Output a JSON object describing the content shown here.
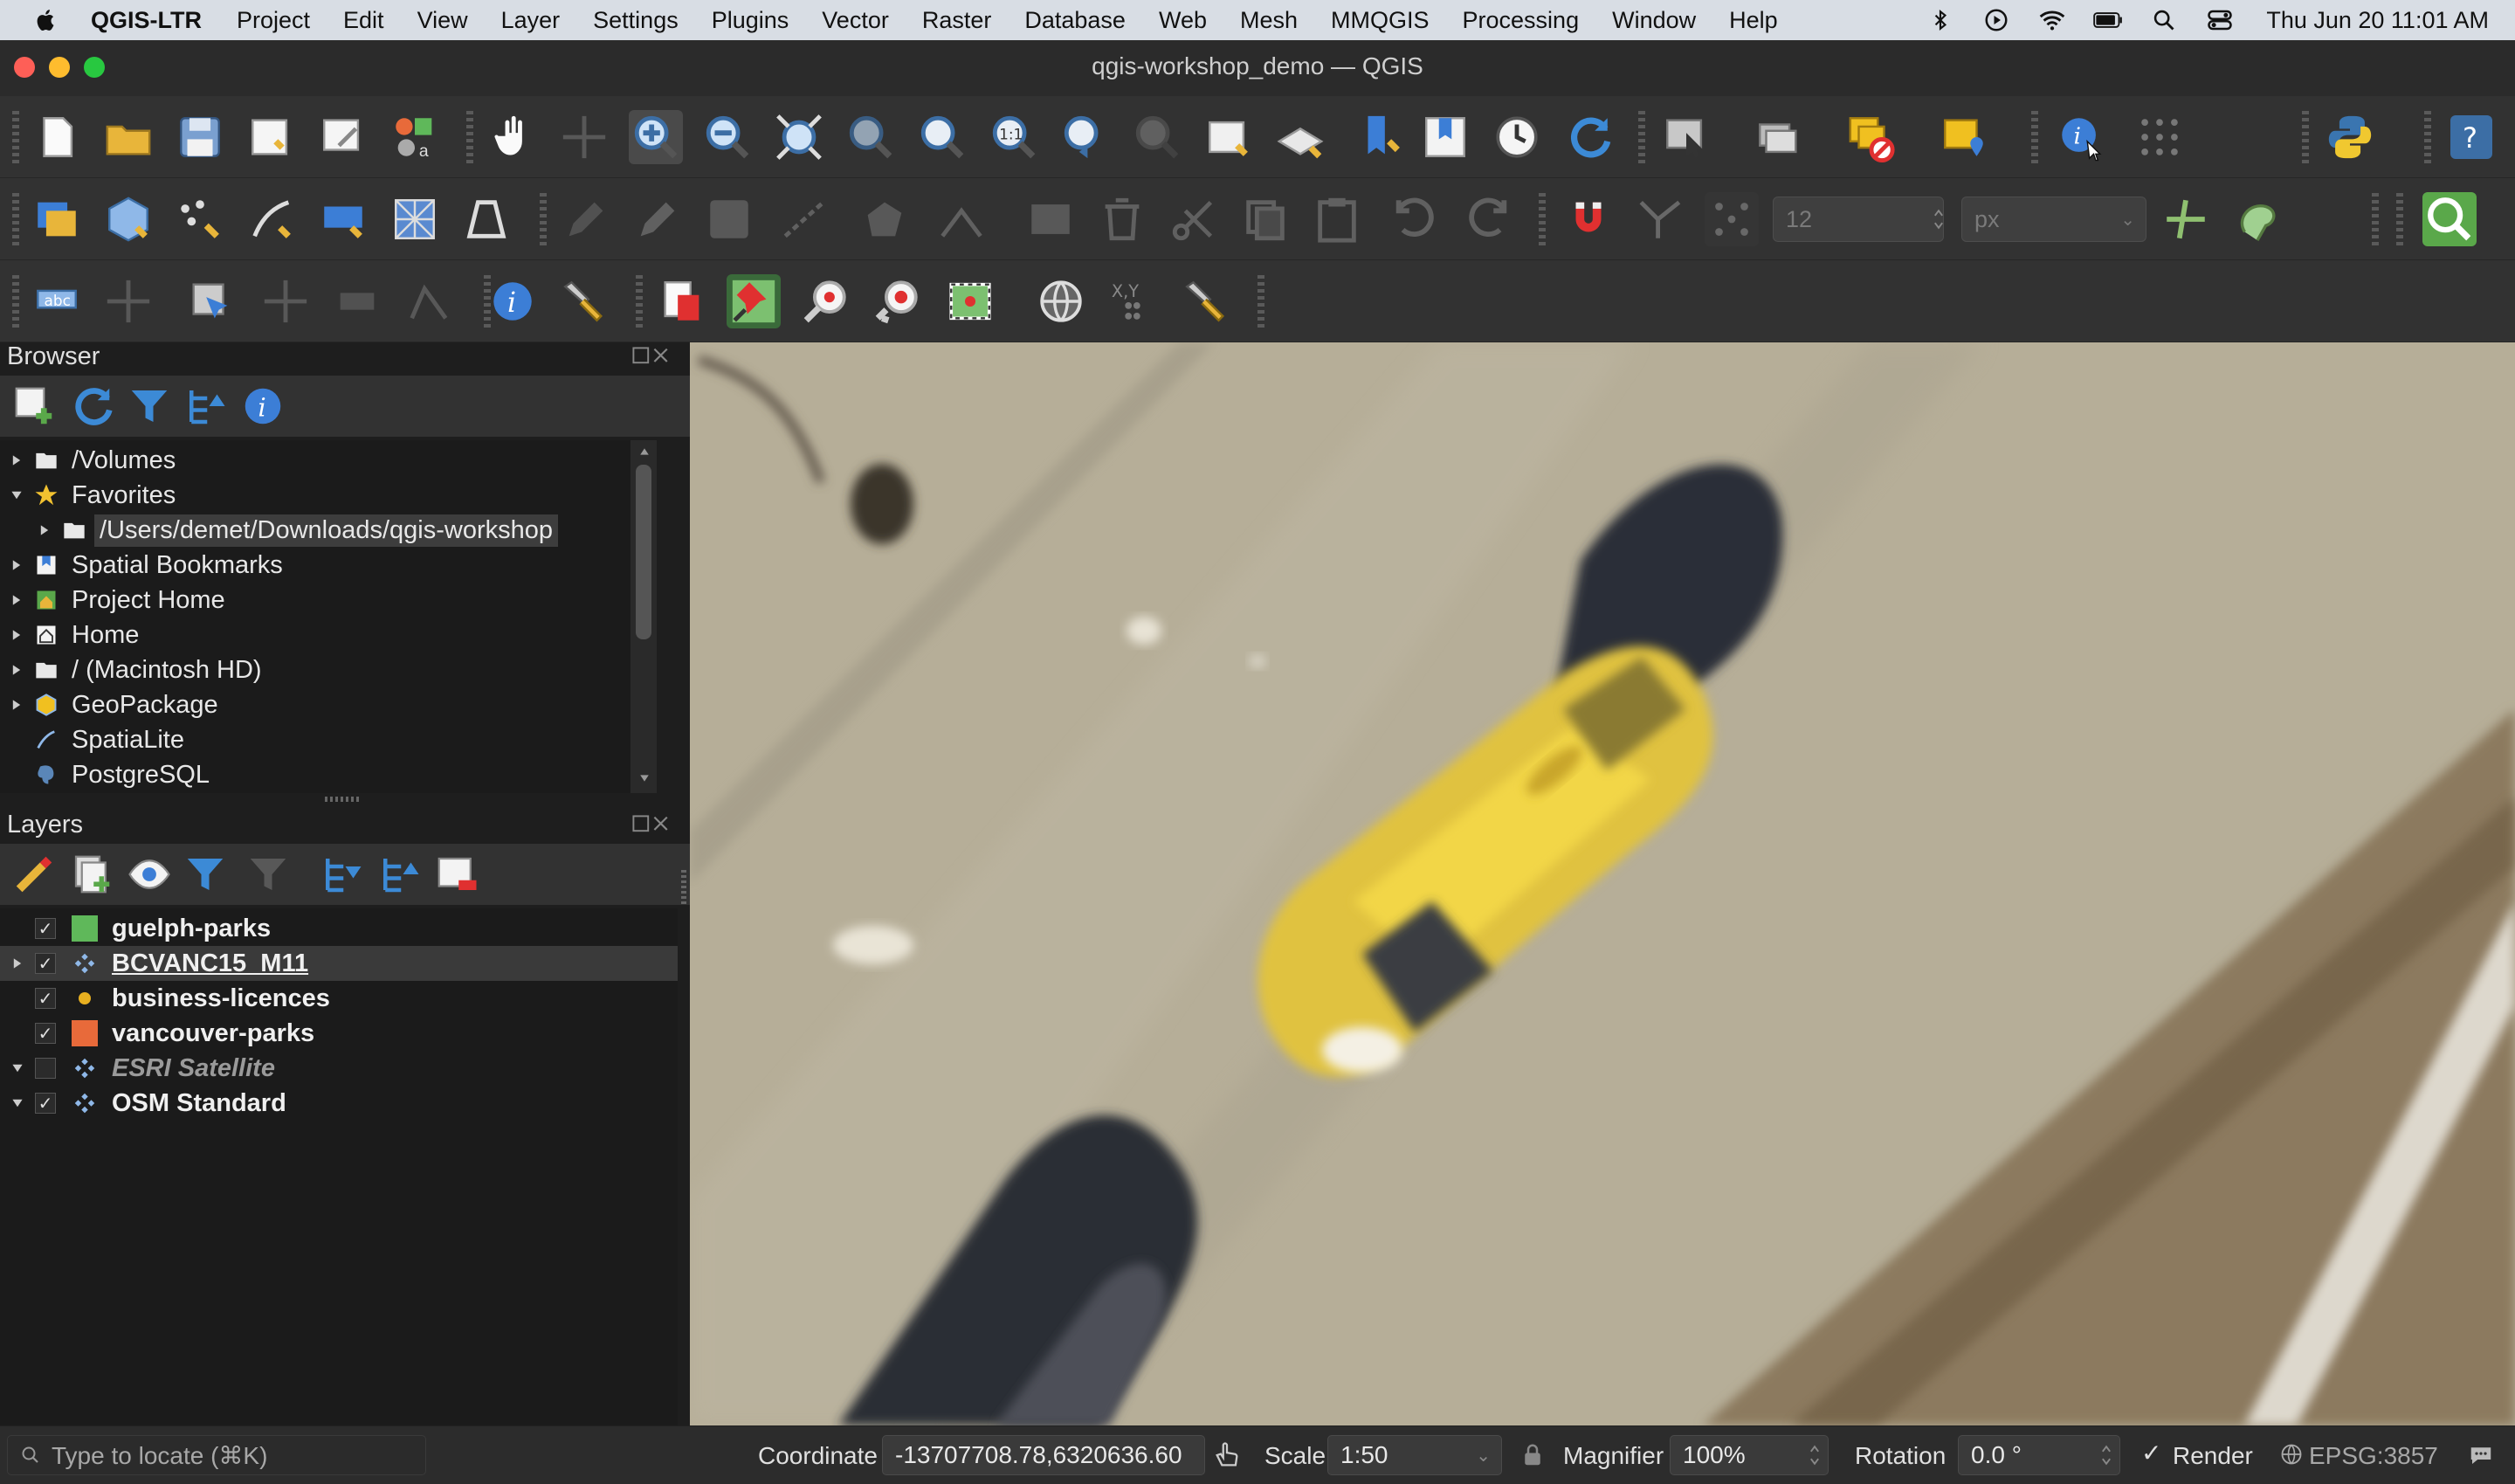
{
  "menubar": {
    "app_name": "QGIS-LTR",
    "items": [
      "Project",
      "Edit",
      "View",
      "Layer",
      "Settings",
      "Plugins",
      "Vector",
      "Raster",
      "Database",
      "Web",
      "Mesh",
      "MMQGIS",
      "Processing",
      "Window",
      "Help"
    ],
    "clock": "Thu Jun 20  11:01 AM",
    "status_icons": [
      "bluetooth-icon",
      "play-icon",
      "wifi-icon",
      "battery-icon",
      "spotlight-icon",
      "control-center-icon"
    ]
  },
  "window": {
    "title": "qgis-workshop_demo — QGIS"
  },
  "toolbar": {
    "font_size_value": "12",
    "font_unit_value": "px"
  },
  "browser": {
    "title": "Browser",
    "items": [
      {
        "label": "/Volumes",
        "icon": "folder-icon",
        "expandable": true
      },
      {
        "label": "Favorites",
        "icon": "star-icon",
        "expandable": true,
        "expanded": true
      },
      {
        "label": "/Users/demet/Downloads/qgis-workshop",
        "icon": "folder-icon",
        "expandable": true,
        "indent": 1,
        "selected": true
      },
      {
        "label": "Spatial Bookmarks",
        "icon": "bookmark-icon",
        "expandable": true
      },
      {
        "label": "Project Home",
        "icon": "project-home-icon",
        "expandable": true
      },
      {
        "label": "Home",
        "icon": "home-icon",
        "expandable": true
      },
      {
        "label": "/ (Macintosh HD)",
        "icon": "folder-icon",
        "expandable": true
      },
      {
        "label": "GeoPackage",
        "icon": "geopackage-icon",
        "expandable": true
      },
      {
        "label": "SpatiaLite",
        "icon": "spatialite-icon",
        "expandable": false
      },
      {
        "label": "PostgreSQL",
        "icon": "postgresql-icon",
        "expandable": false
      }
    ]
  },
  "layers": {
    "title": "Layers",
    "items": [
      {
        "label": "guelph-parks",
        "checked": true,
        "symbol": "polygon",
        "color": "#5fb85a",
        "arrow": false
      },
      {
        "label": "BCVANC15_M11",
        "checked": true,
        "symbol": "raster",
        "arrow": "right",
        "selected": true,
        "underline": true
      },
      {
        "label": "business-licences",
        "checked": true,
        "symbol": "point",
        "color": "#e8b020",
        "arrow": false
      },
      {
        "label": "vancouver-parks",
        "checked": true,
        "symbol": "polygon",
        "color": "#e86a3a",
        "arrow": false
      },
      {
        "label": "ESRI Satellite",
        "checked": false,
        "symbol": "raster",
        "arrow": "down",
        "italic": true
      },
      {
        "label": "OSM Standard",
        "checked": true,
        "symbol": "raster",
        "arrow": "down"
      }
    ]
  },
  "statusbar": {
    "locate_placeholder": "Type to locate (⌘K)",
    "coordinate_label": "Coordinate",
    "coordinate_value": "-13707708.78,6320636.60",
    "scale_label": "Scale",
    "scale_value": "1:50",
    "magnifier_label": "Magnifier",
    "magnifier_value": "100%",
    "rotation_label": "Rotation",
    "rotation_value": "0.0 °",
    "render_label": "Render",
    "render_checked": true,
    "crs_label": "EPSG:3857"
  }
}
